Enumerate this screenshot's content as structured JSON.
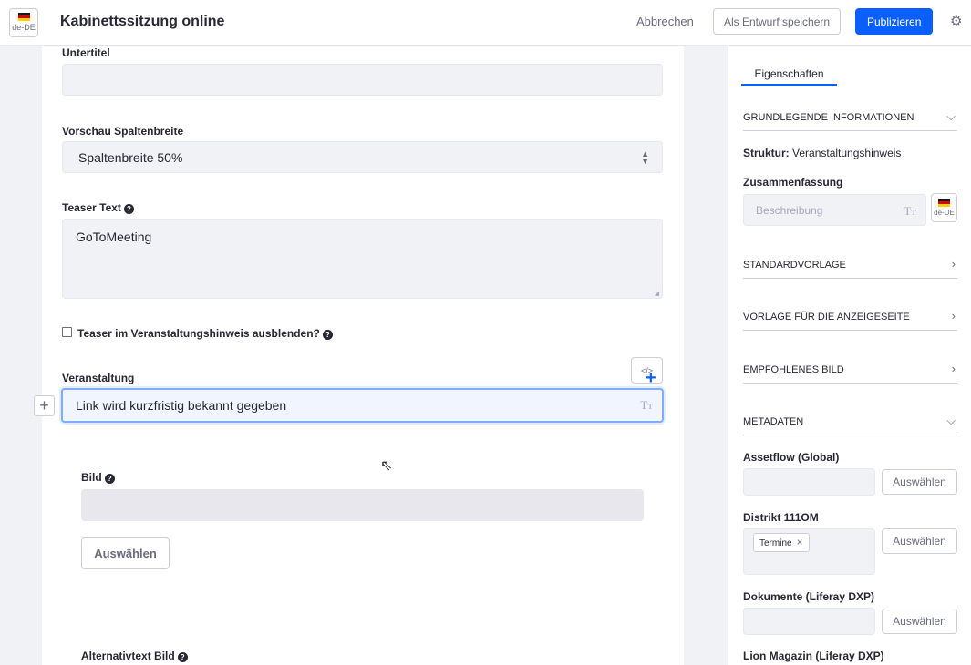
{
  "header": {
    "locale": "de-DE",
    "title": "Kabinettssitzung online",
    "cancel_label": "Abbrechen",
    "draft_label": "Als Entwurf speichern",
    "publish_label": "Publizieren",
    "settings_icon": "gear-icon",
    "accent": "#0b5fff"
  },
  "form": {
    "subtitle_label": "Untertitel",
    "subtitle_value": "",
    "column_label": "Vorschau Spaltenbreite",
    "column_value": "Spaltenbreite 50%",
    "teaser_label": "Teaser Text",
    "teaser_value": "GoToMeeting",
    "hide_teaser_label": "Teaser im Veranstaltungshinweis ausblenden?",
    "hide_teaser_checked": false,
    "event_label": "Veranstaltung",
    "event_value": "Link wird kurzfristig bekannt gegeben",
    "image_label": "Bild",
    "image_select_label": "Auswählen",
    "alt_label": "Alternativtext Bild"
  },
  "sidebar": {
    "tab_label": "Eigenschaften",
    "basic_info_label": "GRUNDLEGENDE INFORMATIONEN",
    "structure_key": "Struktur:",
    "structure_value": "Veranstaltungshinweis",
    "summary_label": "Zusammenfassung",
    "summary_placeholder": "Beschreibung",
    "summary_locale": "de-DE",
    "default_template_label": "STANDARDVORLAGE",
    "display_page_label": "VORLAGE FÜR DIE ANZEIGESEITE",
    "featured_image_label": "EMPFOHLENES BILD",
    "metadata_label": "METADATEN",
    "assetflow_label": "Assetflow (Global)",
    "district_label": "Distrikt 111OM",
    "district_tag": "Termine",
    "documents_label": "Dokumente (Liferay DXP)",
    "lion_label": "Lion Magazin (Liferay DXP)",
    "select_label": "Auswählen"
  }
}
